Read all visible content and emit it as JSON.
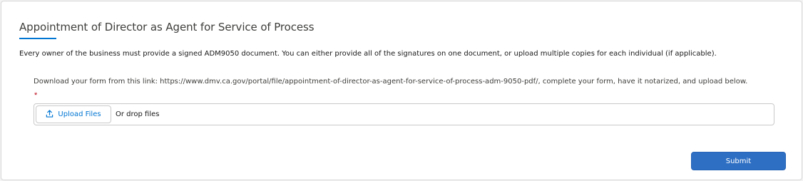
{
  "section": {
    "title": "Appointment of Director as Agent for Service of Process",
    "intro": "Every owner of the business must provide a signed ADM9050 document. You can either provide all of the signatures on one document, or upload multiple copies for each individual (if applicable)."
  },
  "download": {
    "prefix": "Download your form from this link: ",
    "link_text": "https://www.dmv.ca.gov/portal/file/appointment-of-director-as-agent-for-service-of-process-adm-9050-pdf/",
    "suffix": ", complete your form, have it notarized, and upload below."
  },
  "upload": {
    "required_marker": "*",
    "button_label": "Upload Files",
    "drop_text": "Or drop files",
    "icon": "upload-icon"
  },
  "actions": {
    "submit_label": "Submit"
  },
  "colors": {
    "accent": "#0176d3",
    "submit_bg": "#2e6fc4",
    "required": "#ba0517"
  }
}
